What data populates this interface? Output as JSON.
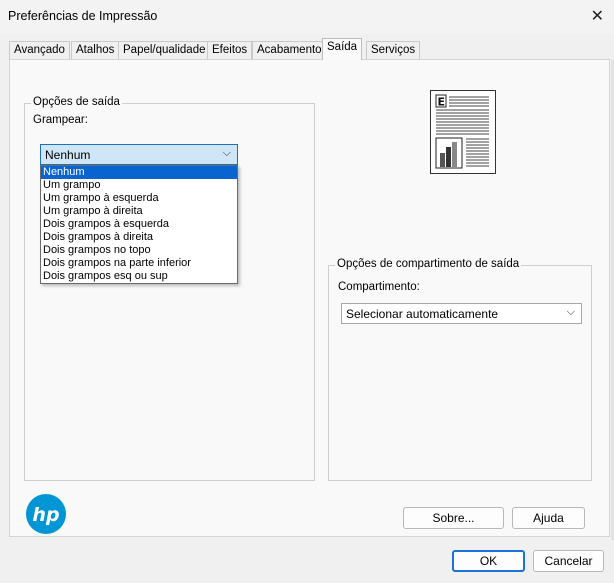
{
  "window": {
    "title": "Preferências de Impressão",
    "close_glyph": "✕"
  },
  "tabs": [
    {
      "label": "Avançado",
      "active": false
    },
    {
      "label": "Atalhos",
      "active": false
    },
    {
      "label": "Papel/qualidade",
      "active": false
    },
    {
      "label": "Efeitos",
      "active": false
    },
    {
      "label": "Acabamento",
      "active": false
    },
    {
      "label": "Saída",
      "active": true
    },
    {
      "label": "Serviços",
      "active": false
    }
  ],
  "output_options": {
    "legend": "Opções de saída",
    "staple_label": "Grampear:",
    "staple_value": "Nenhum",
    "staple_options": [
      "Nenhum",
      "Um grampo",
      "Um grampo à esquerda",
      "Um grampo à direita",
      "Dois grampos à esquerda",
      "Dois grampos à direita",
      "Dois grampos no topo",
      "Dois grampos na parte inferior",
      "Dois grampos esq ou sup"
    ],
    "selected_index": 0
  },
  "bin_options": {
    "legend": "Opções de compartimento de saída",
    "bin_label": "Compartimento:",
    "bin_value": "Selecionar automaticamente"
  },
  "preview": {
    "icon": "document-preview-icon",
    "letter": "E"
  },
  "buttons": {
    "about": "Sobre...",
    "help": "Ajuda",
    "ok": "OK",
    "cancel": "Cancelar"
  },
  "brand": {
    "logo_text": "hp",
    "logo_color": "#0096d6"
  },
  "colors": {
    "selection": "#0a64d0",
    "focus_border": "#1a73d8",
    "combo_focus_bg": "#cfe6f7"
  },
  "chevron_glyph": "⌵"
}
